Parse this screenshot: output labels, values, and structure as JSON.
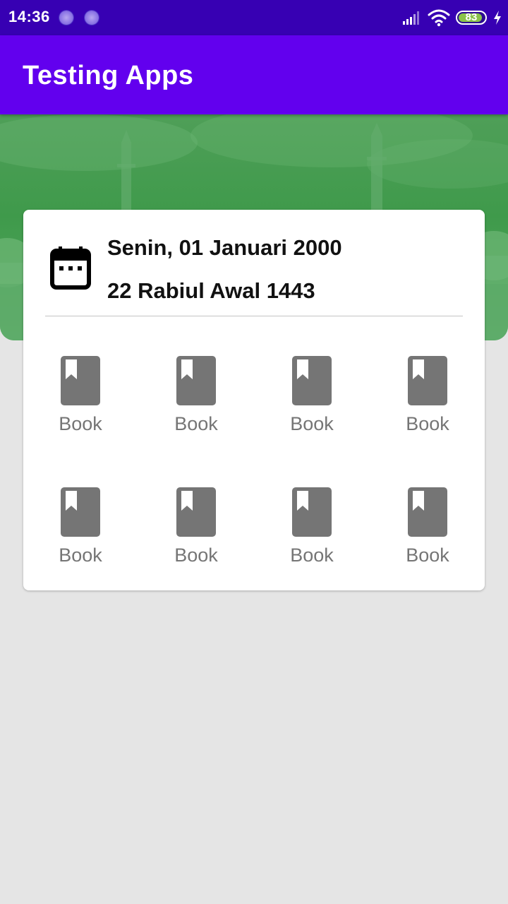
{
  "status_bar": {
    "time": "14:36",
    "battery_level": "83",
    "icons": [
      "notification-icon",
      "notification-icon",
      "signal-icon",
      "wifi-icon",
      "battery-icon",
      "charging-icon"
    ]
  },
  "app_bar": {
    "title": "Testing Apps"
  },
  "date_card": {
    "gregorian_date": "Senin, 01 Januari 2000",
    "hijri_date": "22 Rabiul Awal 1443",
    "icon": "calendar-icon"
  },
  "menu": {
    "items": [
      {
        "label": "Book",
        "icon": "book-icon"
      },
      {
        "label": "Book",
        "icon": "book-icon"
      },
      {
        "label": "Book",
        "icon": "book-icon"
      },
      {
        "label": "Book",
        "icon": "book-icon"
      },
      {
        "label": "Book",
        "icon": "book-icon"
      },
      {
        "label": "Book",
        "icon": "book-icon"
      },
      {
        "label": "Book",
        "icon": "book-icon"
      },
      {
        "label": "Book",
        "icon": "book-icon"
      }
    ]
  },
  "colors": {
    "status_bar": "#3700b3",
    "app_bar": "#6200ee",
    "banner": "#43a04f",
    "background": "#e5e5e5",
    "icon_gray": "#757575"
  }
}
